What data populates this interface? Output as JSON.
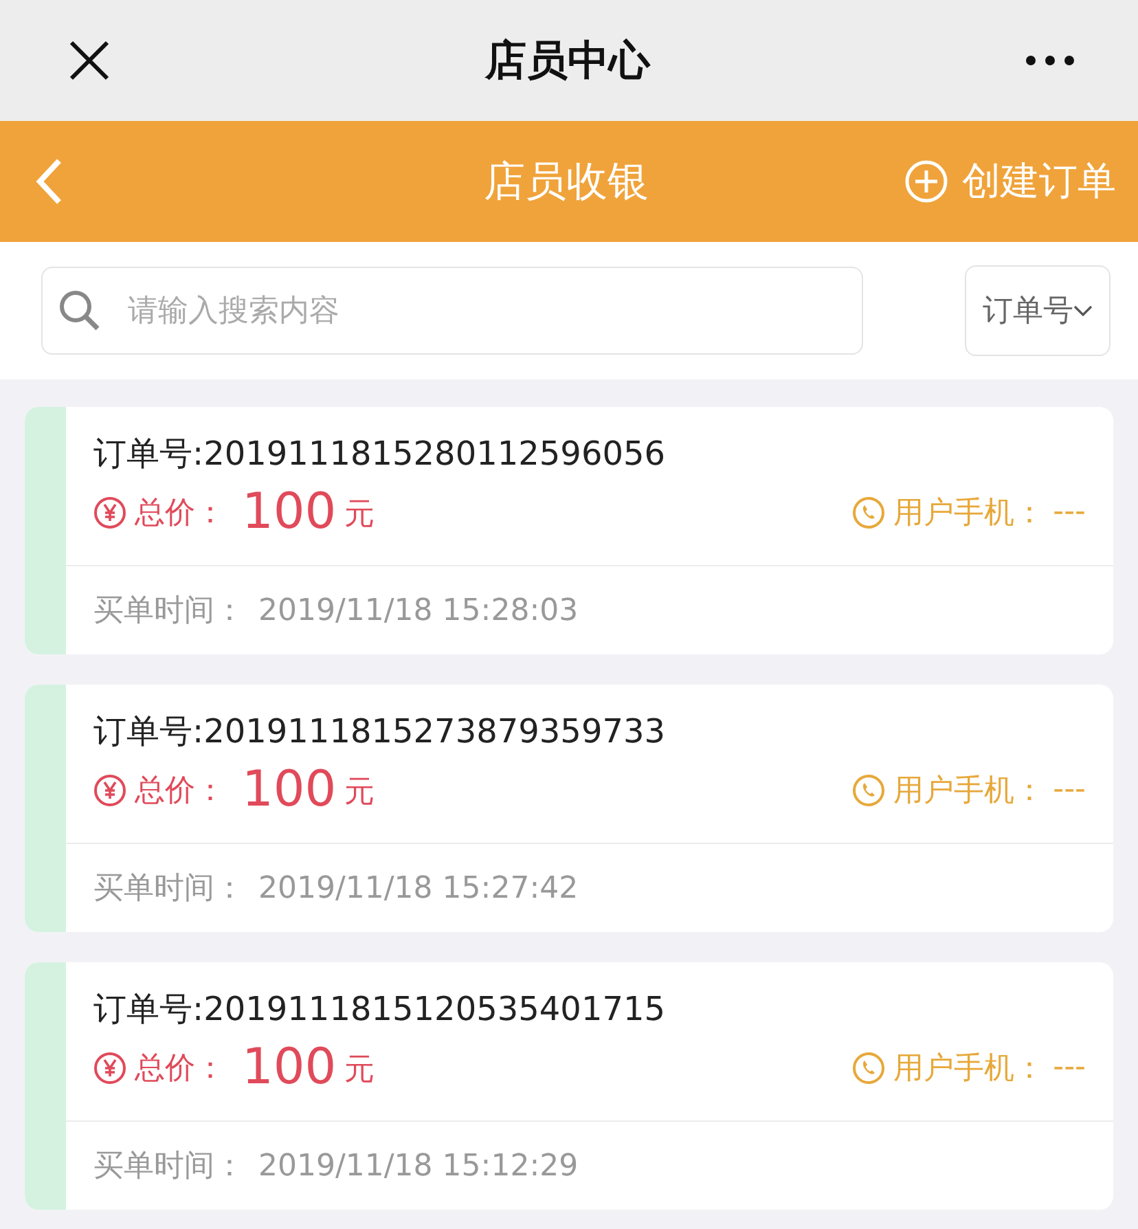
{
  "window": {
    "title": "店员中心"
  },
  "header": {
    "title": "店员收银",
    "action": "创建订单"
  },
  "search": {
    "placeholder": "请输入搜索内容",
    "filter": "订单号"
  },
  "orders": [
    {
      "order_no": "订单号:2019111815280112596056",
      "price_label": "总价：",
      "amount": "100",
      "unit": "元",
      "phone_label": "用户手机：",
      "phone": "---",
      "time_label": "买单时间：",
      "time": "2019/11/18 15:28:03"
    },
    {
      "order_no": "订单号:2019111815273879359733",
      "price_label": "总价：",
      "amount": "100",
      "unit": "元",
      "phone_label": "用户手机：",
      "phone": "---",
      "time_label": "买单时间：",
      "time": "2019/11/18 15:27:42"
    },
    {
      "order_no": "订单号:2019111815120535401715",
      "price_label": "总价：",
      "amount": "100",
      "unit": "元",
      "phone_label": "用户手机：",
      "phone": "---",
      "time_label": "买单时间：",
      "time": "2019/11/18 15:12:29"
    }
  ]
}
